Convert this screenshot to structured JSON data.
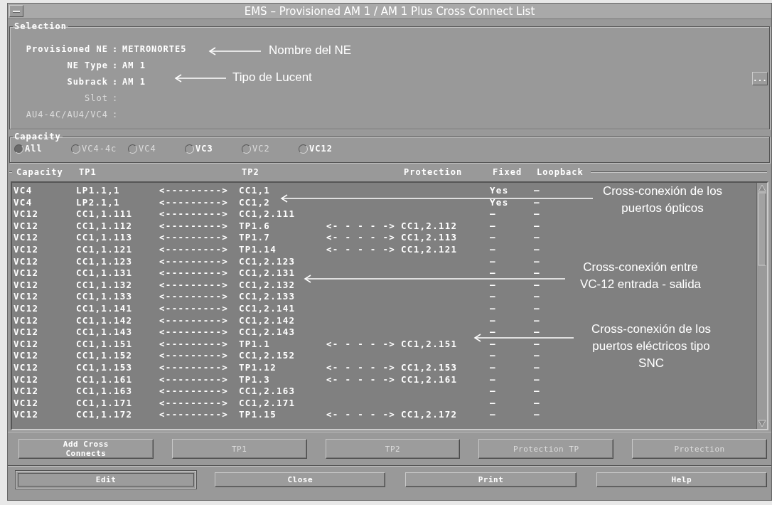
{
  "window": {
    "title": "EMS – Provisioned AM 1 / AM 1 Plus Cross Connect List"
  },
  "selection": {
    "title": "Selection",
    "fields": [
      {
        "label": "Provisioned NE",
        "separator": ":",
        "value": "METRONORTE5",
        "disabled": false
      },
      {
        "label": "NE Type",
        "separator": ":",
        "value": "AM 1",
        "disabled": false
      },
      {
        "label": "Subrack",
        "separator": ":",
        "value": "AM 1",
        "disabled": false
      },
      {
        "label": "Slot",
        "separator": ":",
        "disabled": true
      },
      {
        "label": "AU4-4C/AU4/VC4",
        "separator": ":",
        "disabled": true
      }
    ],
    "more_button": "..."
  },
  "capacity_filter": {
    "title": "Capacity",
    "options": [
      {
        "label": "All",
        "selected": true,
        "disabled": false
      },
      {
        "label": "VC4-4c",
        "selected": false,
        "disabled": true
      },
      {
        "label": "VC4",
        "selected": false,
        "disabled": true
      },
      {
        "label": "VC3",
        "selected": false,
        "disabled": false
      },
      {
        "label": "VC2",
        "selected": false,
        "disabled": true
      },
      {
        "label": "VC12",
        "selected": false,
        "disabled": false
      }
    ]
  },
  "table": {
    "columns": [
      "Capacity",
      "TP1",
      "TP2",
      "Protection",
      "Fixed",
      "Loopback"
    ],
    "rows": [
      {
        "capacity": "VC4",
        "tp1": "LP1.1,1",
        "link": "<--------->",
        "tp2": "CC1,1",
        "fixed": "Yes",
        "loopback": "–"
      },
      {
        "capacity": "VC4",
        "tp1": "LP2.1,1",
        "link": "<--------->",
        "tp2": "CC1,2",
        "fixed": "Yes",
        "loopback": "–"
      },
      {
        "capacity": "VC12",
        "tp1": "CC1,1.111",
        "link": "<--------->",
        "tp2": "CC1,2.111",
        "fixed": "–",
        "loopback": "–"
      },
      {
        "capacity": "VC12",
        "tp1": "CC1,1.112",
        "link": "<--------->",
        "tp2": "TP1.6",
        "protection_link": "<- - - - ->",
        "protection": "CC1,2.112",
        "fixed": "–",
        "loopback": "–"
      },
      {
        "capacity": "VC12",
        "tp1": "CC1,1.113",
        "link": "<--------->",
        "tp2": "TP1.7",
        "protection_link": "<- - - - ->",
        "protection": "CC1,2.113",
        "fixed": "–",
        "loopback": "–"
      },
      {
        "capacity": "VC12",
        "tp1": "CC1,1.121",
        "link": "<--------->",
        "tp2": "TP1.14",
        "protection_link": "<- - - - ->",
        "protection": "CC1,2.121",
        "fixed": "–",
        "loopback": "–"
      },
      {
        "capacity": "VC12",
        "tp1": "CC1,1.123",
        "link": "<--------->",
        "tp2": "CC1,2.123",
        "fixed": "–",
        "loopback": "–"
      },
      {
        "capacity": "VC12",
        "tp1": "CC1,1.131",
        "link": "<--------->",
        "tp2": "CC1,2.131",
        "fixed": "–",
        "loopback": "–"
      },
      {
        "capacity": "VC12",
        "tp1": "CC1,1.132",
        "link": "<--------->",
        "tp2": "CC1,2.132",
        "fixed": "–",
        "loopback": "–"
      },
      {
        "capacity": "VC12",
        "tp1": "CC1,1.133",
        "link": "<--------->",
        "tp2": "CC1,2.133",
        "fixed": "–",
        "loopback": "–"
      },
      {
        "capacity": "VC12",
        "tp1": "CC1,1.141",
        "link": "<--------->",
        "tp2": "CC1,2.141",
        "fixed": "–",
        "loopback": "–"
      },
      {
        "capacity": "VC12",
        "tp1": "CC1,1.142",
        "link": "<--------->",
        "tp2": "CC1,2.142",
        "fixed": "–",
        "loopback": "–"
      },
      {
        "capacity": "VC12",
        "tp1": "CC1,1.143",
        "link": "<--------->",
        "tp2": "CC1,2.143",
        "fixed": "–",
        "loopback": "–"
      },
      {
        "capacity": "VC12",
        "tp1": "CC1,1.151",
        "link": "<--------->",
        "tp2": "TP1.1",
        "protection_link": "<- - - - ->",
        "protection": "CC1,2.151",
        "fixed": "–",
        "loopback": "–"
      },
      {
        "capacity": "VC12",
        "tp1": "CC1,1.152",
        "link": "<--------->",
        "tp2": "CC1,2.152",
        "fixed": "–",
        "loopback": "–"
      },
      {
        "capacity": "VC12",
        "tp1": "CC1,1.153",
        "link": "<--------->",
        "tp2": "TP1.12",
        "protection_link": "<- - - - ->",
        "protection": "CC1,2.153",
        "fixed": "–",
        "loopback": "–"
      },
      {
        "capacity": "VC12",
        "tp1": "CC1,1.161",
        "link": "<--------->",
        "tp2": "TP1.3",
        "protection_link": "<- - - - ->",
        "protection": "CC1,2.161",
        "fixed": "–",
        "loopback": "–"
      },
      {
        "capacity": "VC12",
        "tp1": "CC1,1.163",
        "link": "<--------->",
        "tp2": "CC1,2.163",
        "fixed": "–",
        "loopback": "–"
      },
      {
        "capacity": "VC12",
        "tp1": "CC1,1.171",
        "link": "<--------->",
        "tp2": "CC1,2.171",
        "fixed": "–",
        "loopback": "–"
      },
      {
        "capacity": "VC12",
        "tp1": "CC1,1.172",
        "link": "<--------->",
        "tp2": "TP1.15",
        "protection_link": "<- - - - ->",
        "protection": "CC1,2.172",
        "fixed": "–",
        "loopback": "–"
      }
    ]
  },
  "action_buttons": [
    {
      "label": "Add Cross\nConnects",
      "disabled": false
    },
    {
      "label": "TP1",
      "disabled": true
    },
    {
      "label": "TP2",
      "disabled": true
    },
    {
      "label": "Protection TP",
      "disabled": true
    },
    {
      "label": "Protection",
      "disabled": true
    }
  ],
  "dialog_buttons": [
    {
      "label": "Edit",
      "default": true
    },
    {
      "label": "Close",
      "default": false
    },
    {
      "label": "Print",
      "default": false
    },
    {
      "label": "Help",
      "default": false
    }
  ],
  "annotations": [
    {
      "text": "Nombre del NE"
    },
    {
      "text": "Tipo de Lucent"
    },
    {
      "text": "Cross-conexión de los\npuertos ópticos"
    },
    {
      "text": "Cross-conexión entre\nVC-12 entrada - salida"
    },
    {
      "text": "Cross-conexión de los\npuertos eléctricos tipo\nSNC"
    }
  ]
}
